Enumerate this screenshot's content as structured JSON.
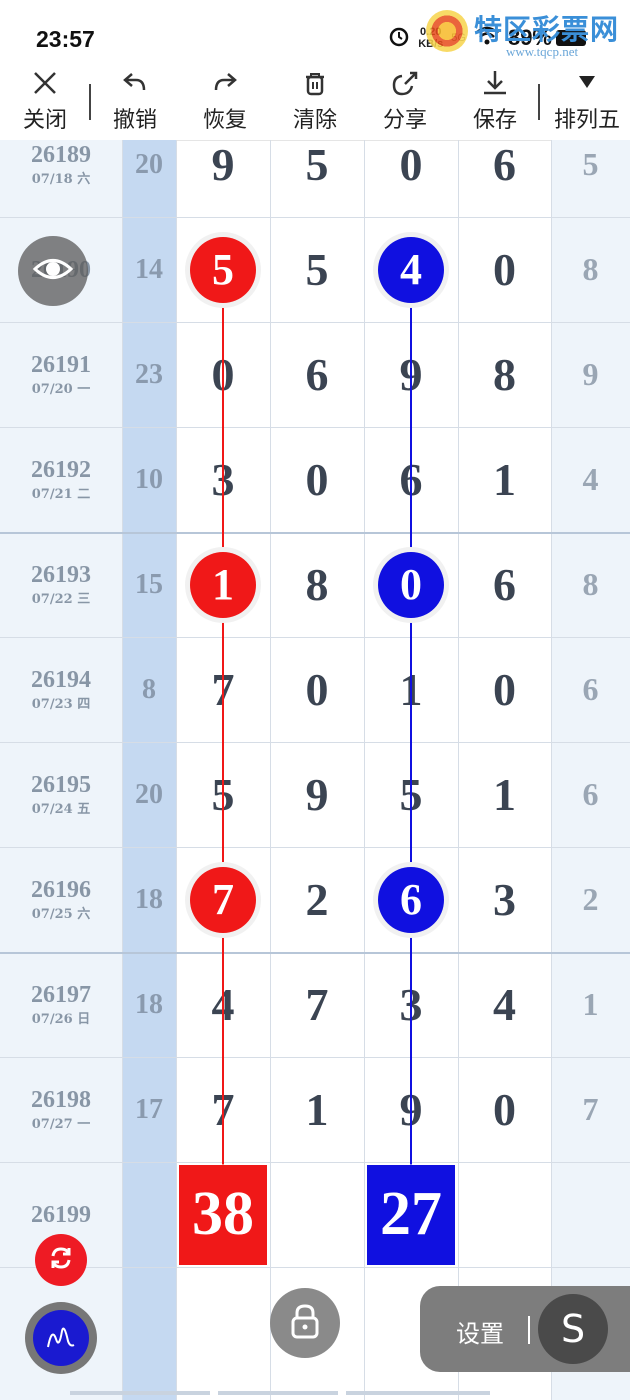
{
  "status_bar": {
    "time": "23:57",
    "net_speed": "0.20",
    "net_unit": "KB/s",
    "signal_type": "5G",
    "battery": "89%",
    "watermark_site": "特区彩票网",
    "watermark_url": "www.tqcp.net"
  },
  "toolbar": {
    "close": "关闭",
    "undo": "撤销",
    "redo": "恢复",
    "clear": "清除",
    "share": "分享",
    "save": "保存",
    "lottery": "排列五"
  },
  "rows": [
    {
      "issue": "26189",
      "date": "07/18 六",
      "sum": "20",
      "d1": "9",
      "d2": "5",
      "d3": "0",
      "d4": "6",
      "d5": "5"
    },
    {
      "issue": "26190",
      "date": "",
      "sum": "14",
      "d1": "5",
      "d2": "5",
      "d3": "4",
      "d4": "0",
      "d5": "8"
    },
    {
      "issue": "26191",
      "date": "07/20 一",
      "sum": "23",
      "d1": "0",
      "d2": "6",
      "d3": "9",
      "d4": "8",
      "d5": "9"
    },
    {
      "issue": "26192",
      "date": "07/21 二",
      "sum": "10",
      "d1": "3",
      "d2": "0",
      "d3": "6",
      "d4": "1",
      "d5": "4"
    },
    {
      "issue": "26193",
      "date": "07/22 三",
      "sum": "15",
      "d1": "1",
      "d2": "8",
      "d3": "0",
      "d4": "6",
      "d5": "8"
    },
    {
      "issue": "26194",
      "date": "07/23 四",
      "sum": "8",
      "d1": "7",
      "d2": "0",
      "d3": "1",
      "d4": "0",
      "d5": "6"
    },
    {
      "issue": "26195",
      "date": "07/24 五",
      "sum": "20",
      "d1": "5",
      "d2": "9",
      "d3": "5",
      "d4": "1",
      "d5": "6"
    },
    {
      "issue": "26196",
      "date": "07/25 六",
      "sum": "18",
      "d1": "7",
      "d2": "2",
      "d3": "6",
      "d4": "3",
      "d5": "2"
    },
    {
      "issue": "26197",
      "date": "07/26 日",
      "sum": "18",
      "d1": "4",
      "d2": "7",
      "d3": "3",
      "d4": "4",
      "d5": "1"
    },
    {
      "issue": "26198",
      "date": "07/27 一",
      "sum": "17",
      "d1": "7",
      "d2": "1",
      "d3": "9",
      "d4": "0",
      "d5": "7"
    },
    {
      "issue": "26199",
      "date": "",
      "sum": "",
      "d1": "",
      "d2": "",
      "d3": "",
      "d4": "",
      "d5": ""
    }
  ],
  "markers": {
    "red_balls": [
      {
        "row": 1,
        "value": "5"
      },
      {
        "row": 4,
        "value": "1"
      },
      {
        "row": 7,
        "value": "7"
      }
    ],
    "blue_balls": [
      {
        "row": 1,
        "value": "4"
      },
      {
        "row": 4,
        "value": "0"
      },
      {
        "row": 7,
        "value": "6"
      }
    ],
    "red_total": "38",
    "blue_total": "27",
    "red_color": "#f01818",
    "blue_color": "#1010e0"
  },
  "controls": {
    "settings_label": "设置",
    "s_button": "S"
  }
}
